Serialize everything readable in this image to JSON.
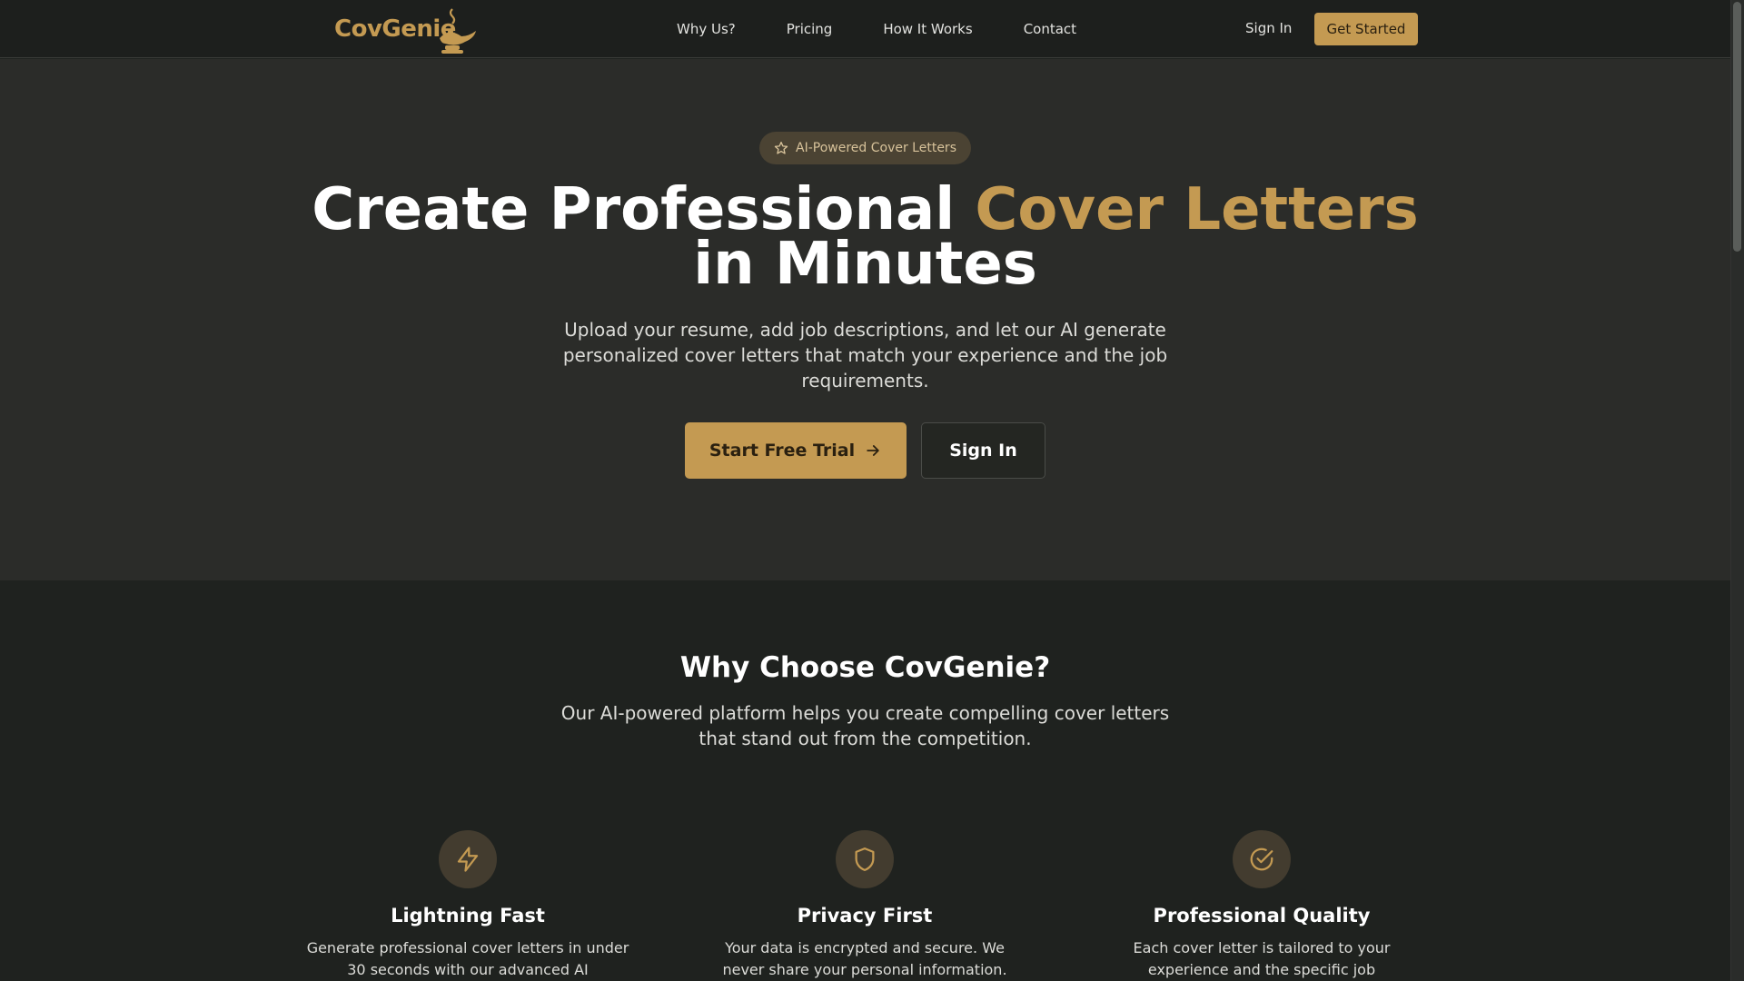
{
  "nav": {
    "logo_text": "CovGenie",
    "links": [
      "Why Us?",
      "Pricing",
      "How It Works",
      "Contact"
    ],
    "sign_in": "Sign In",
    "get_started": "Get Started"
  },
  "hero": {
    "badge": "AI-Powered Cover Letters",
    "title_part1": "Create Professional ",
    "title_accent": "Cover Letters",
    "title_part2": " in Minutes",
    "subtitle": "Upload your resume, add job descriptions, and let our AI generate personalized cover letters that match your experience and the job requirements.",
    "primary_button": "Start Free Trial",
    "secondary_button": "Sign In"
  },
  "features": {
    "title": "Why Choose CovGenie?",
    "subtitle": "Our AI-powered platform helps you create compelling cover letters that stand out from the competition.",
    "items": [
      {
        "icon": "lightning-icon",
        "title": "Lightning Fast",
        "desc": "Generate professional cover letters in under 30 seconds with our advanced AI"
      },
      {
        "icon": "shield-icon",
        "title": "Privacy First",
        "desc": "Your data is encrypted and secure. We never share your personal information."
      },
      {
        "icon": "check-circle-icon",
        "title": "Professional Quality",
        "desc": "Each cover letter is tailored to your experience and the specific job"
      }
    ]
  },
  "colors": {
    "accent": "#c49a52",
    "background": "#1f221f",
    "hero_background": "#2b2c29"
  }
}
